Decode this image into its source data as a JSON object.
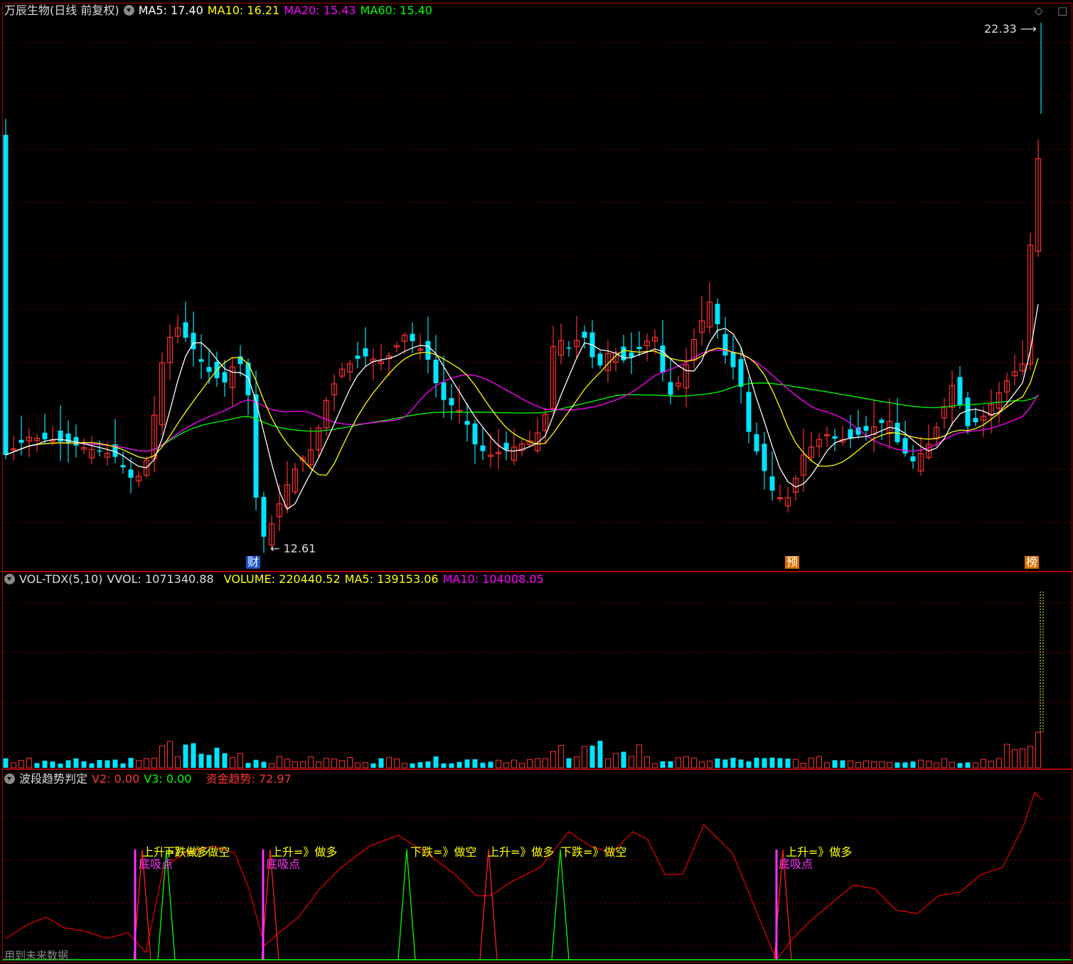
{
  "price_panel": {
    "title": "万辰生物(日线 前复权)",
    "ma_items": [
      {
        "label": "MA5: 17.40",
        "color": "#ffffff"
      },
      {
        "label": "MA10: 16.21",
        "color": "#ffff00"
      },
      {
        "label": "MA20: 15.43",
        "color": "#ff00ff"
      },
      {
        "label": "MA60: 15.40",
        "color": "#00ff00"
      }
    ],
    "high_label": "22.33",
    "low_label": "12.61",
    "markers": [
      "财",
      "预",
      "榜"
    ],
    "diamond_icon": "diamond-icon"
  },
  "volume_panel": {
    "title": "VOL-TDX(5,10)",
    "items": [
      {
        "label": "VVOL: 1071340.88",
        "color": "#dddddd"
      },
      {
        "label": "VOLUME: 220440.52",
        "color": "#ffff00"
      },
      {
        "label": "MA5: 139153.06",
        "color": "#ffff00"
      },
      {
        "label": "MA10: 104008.05",
        "color": "#ff00ff"
      }
    ]
  },
  "indicator_panel": {
    "title": "波段趋势判定",
    "items": [
      {
        "label": "V2: 0.00",
        "color": "#ff3333"
      },
      {
        "label": "V3: 0.00",
        "color": "#00ff00"
      },
      {
        "label": "资金趋势: 72.97",
        "color": "#ff3333"
      }
    ],
    "signals": [
      "上升=》做多",
      "下跌=》做空",
      "上升=》做多",
      "下跌=》做空",
      "上升=》做多",
      "下跌=》做空",
      "上升=》做多"
    ],
    "absorb_labels": [
      "底吸点",
      "底吸点",
      "底吸点"
    ],
    "footer": "用到未来数据"
  },
  "chart_data": {
    "type": "candlestick",
    "colors": {
      "up": "#ff3030",
      "down": "#00e5ff",
      "ma5": "#ffffff",
      "ma10": "#ffff00",
      "ma20": "#ff00ff",
      "ma60": "#00ff00"
    },
    "price_range": [
      12.61,
      22.33
    ]
  }
}
